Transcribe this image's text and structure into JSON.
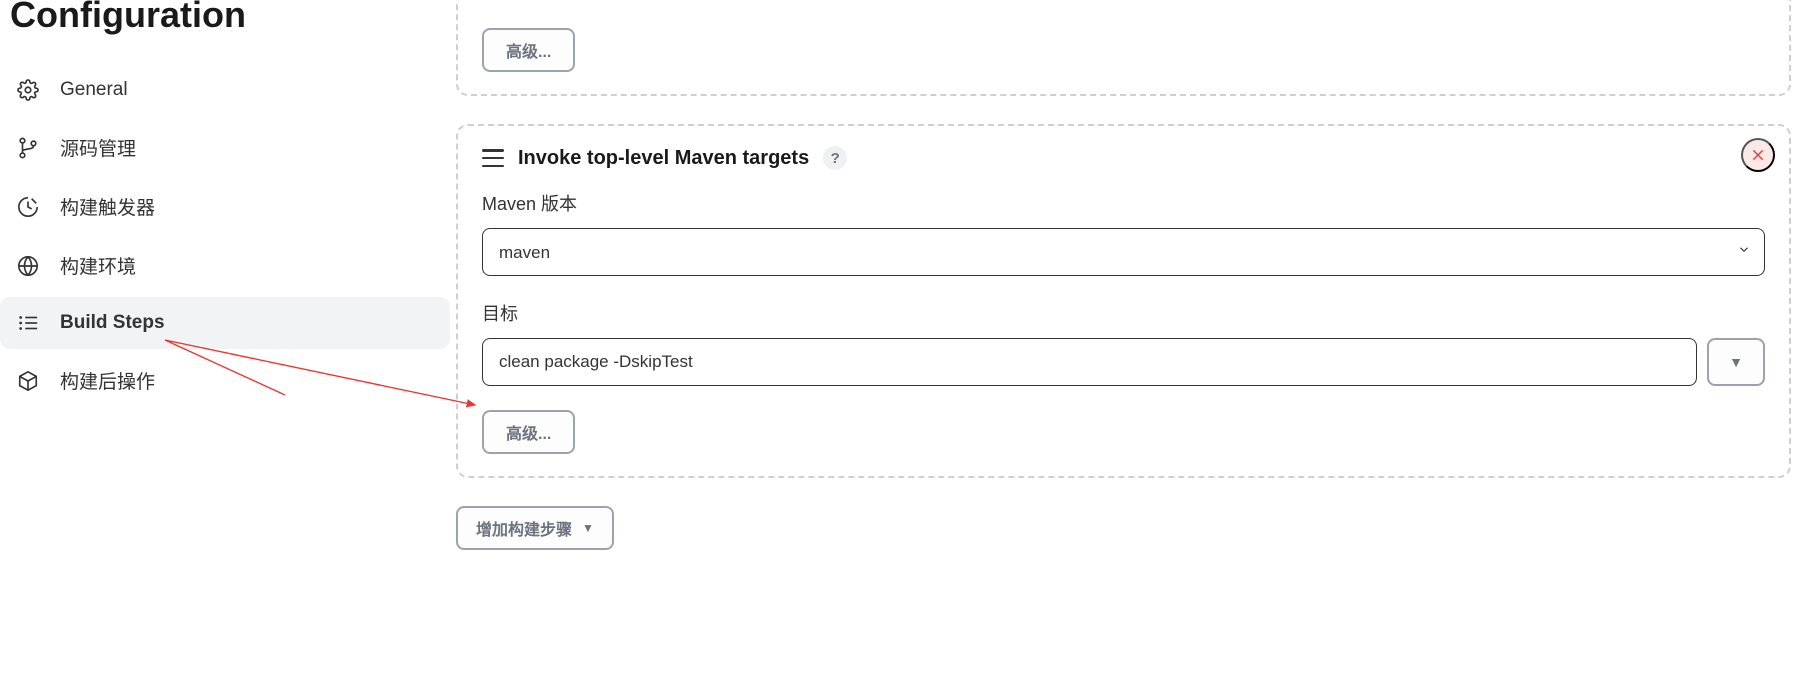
{
  "page": {
    "title": "Configuration"
  },
  "sidebar": {
    "items": [
      {
        "id": "general",
        "label": "General"
      },
      {
        "id": "scm",
        "label": "源码管理"
      },
      {
        "id": "triggers",
        "label": "构建触发器"
      },
      {
        "id": "environment",
        "label": "构建环境"
      },
      {
        "id": "build-steps",
        "label": "Build Steps"
      },
      {
        "id": "post-build",
        "label": "构建后操作"
      }
    ]
  },
  "build_steps": {
    "prior_card": {
      "advanced_label": "高级..."
    },
    "maven_card": {
      "title": "Invoke top-level Maven targets",
      "help": "?",
      "maven_version_label": "Maven 版本",
      "maven_version_value": "maven",
      "goals_label": "目标",
      "goals_value": "clean package -DskipTest",
      "advanced_label": "高级...",
      "expand_symbol": "▼"
    },
    "add_step_label": "增加构建步骤"
  }
}
